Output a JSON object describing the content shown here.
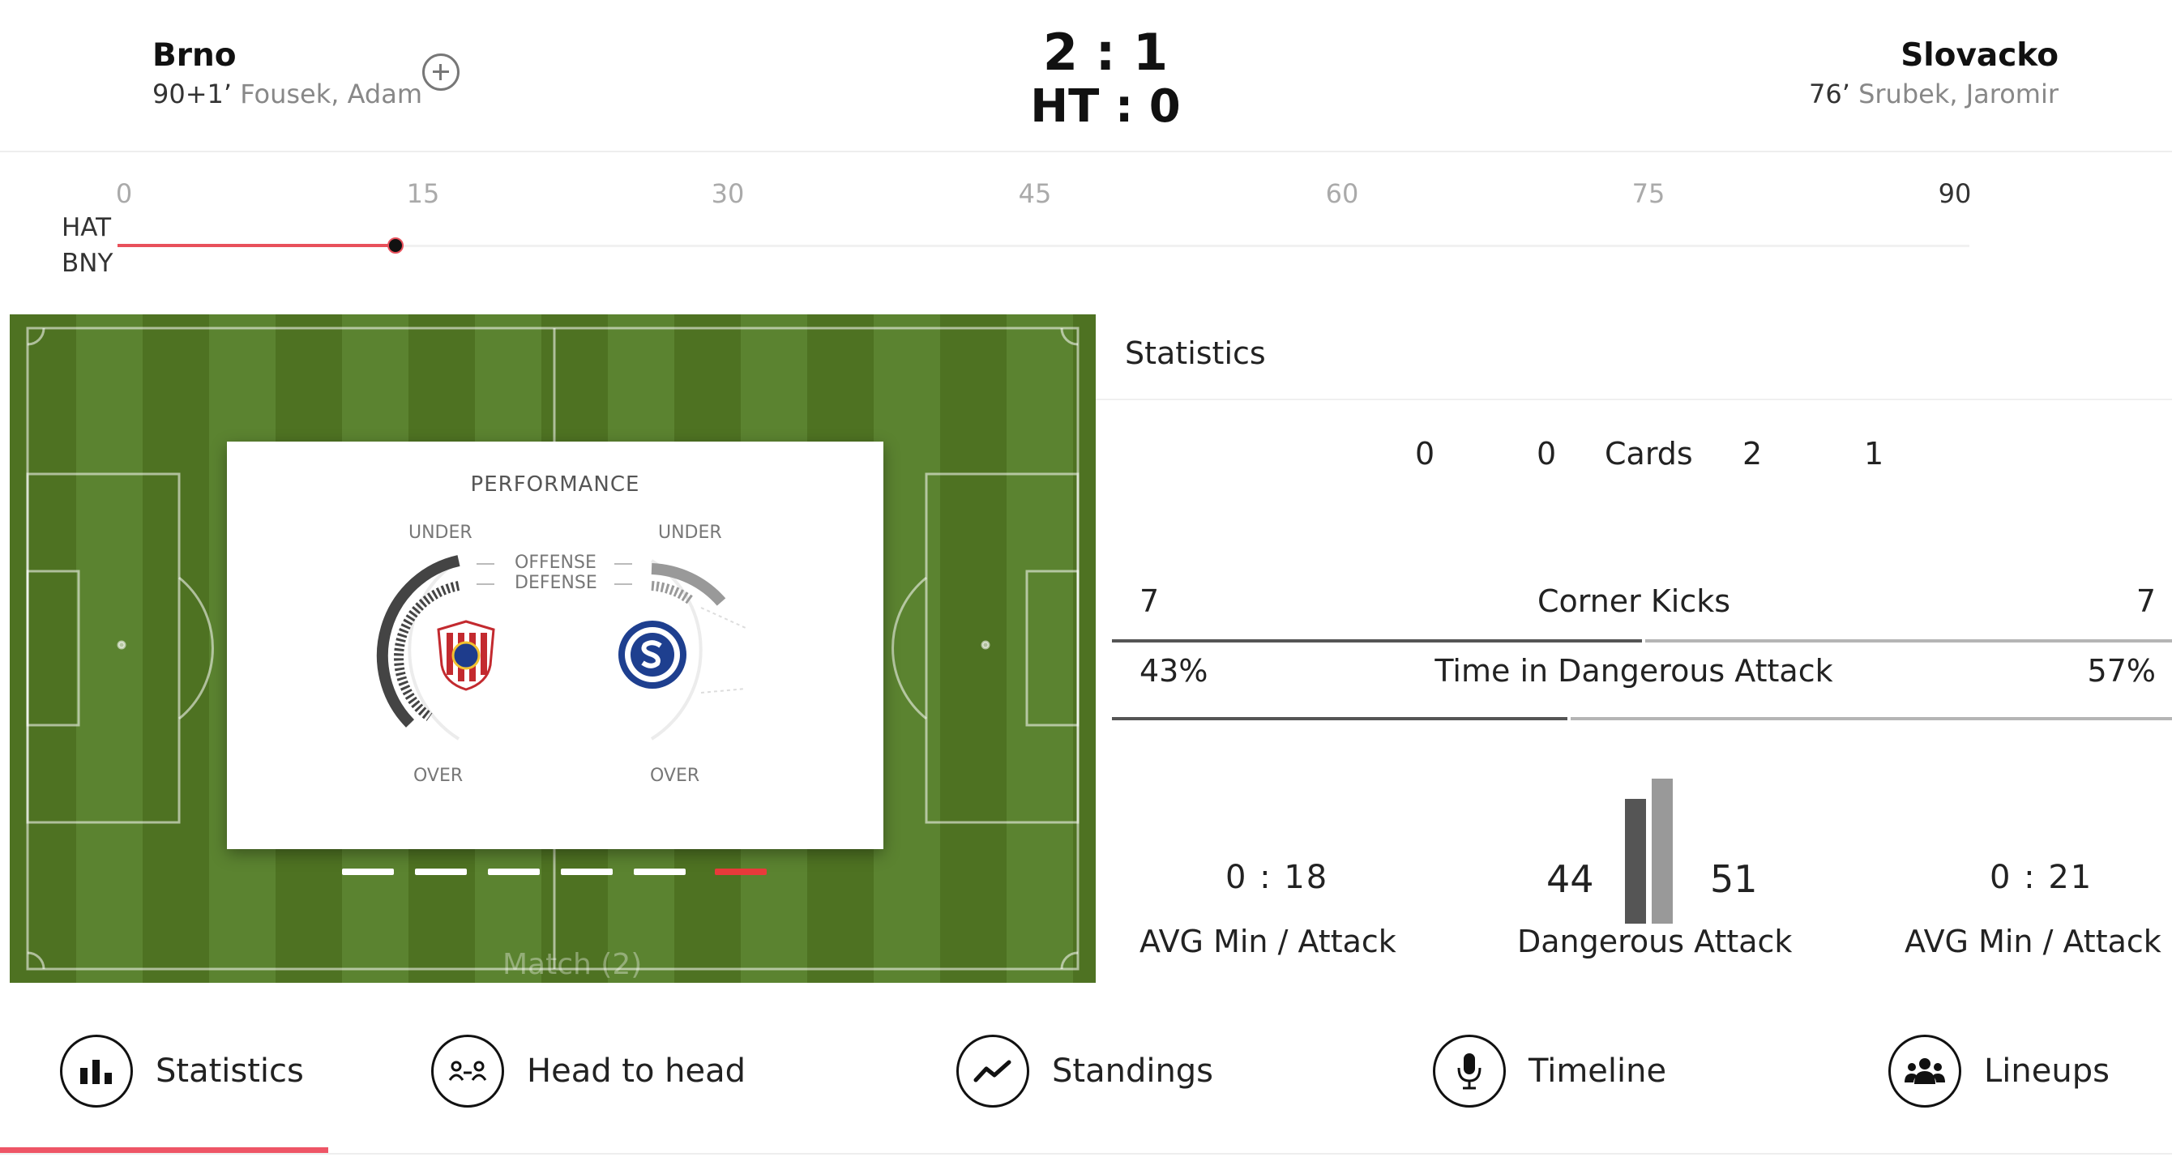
{
  "header": {
    "home": {
      "name": "Brno",
      "goal_minute": "90+1’",
      "goal_scorer": "Fousek, Adam"
    },
    "away": {
      "name": "Slovacko",
      "goal_minute": "76’",
      "goal_scorer": "Srubek, Jaromir"
    },
    "score": "2 : 1",
    "halftime": "HT : 0"
  },
  "timeline": {
    "ticks": [
      "0",
      "15",
      "30",
      "45",
      "60",
      "75",
      "90"
    ],
    "home_abbr": "HAT",
    "away_abbr": "BNY",
    "progress_minute": 13.5,
    "max_minute": 90
  },
  "pitch": {
    "card_title": "PERFORMANCE",
    "label_under": "UNDER",
    "label_over": "OVER",
    "label_offense": "OFFENSE",
    "label_defense": "DEFENSE",
    "page_dots": 6,
    "active_dot": 6,
    "caption": "Match (2)"
  },
  "statistics": {
    "title": "Statistics",
    "cards": {
      "label": "Cards",
      "home_a": "0",
      "home_b": "0",
      "away_a": "2",
      "away_b": "1"
    },
    "corner_kicks": {
      "label": "Corner Kicks",
      "home": "7",
      "away": "7",
      "home_share": 0.5
    },
    "dangerous_time": {
      "label": "Time in Dangerous Attack",
      "home": "43%",
      "away": "57%",
      "home_share": 0.43
    },
    "home_avg": {
      "value": "0 : 18",
      "label": "AVG Min / Attack"
    },
    "away_avg": {
      "value": "0 : 21",
      "label": "AVG Min / Attack"
    },
    "dangerous_attack": {
      "label": "Dangerous Attack",
      "home": "44",
      "away": "51",
      "home_value": 44,
      "away_value": 51
    }
  },
  "nav": {
    "items": [
      {
        "label": "Statistics",
        "icon": "bar-chart-icon"
      },
      {
        "label": "Head to head",
        "icon": "head-to-head-icon"
      },
      {
        "label": "Standings",
        "icon": "trend-line-icon"
      },
      {
        "label": "Timeline",
        "icon": "microphone-icon"
      },
      {
        "label": "Lineups",
        "icon": "people-icon"
      }
    ],
    "active_index": 0
  },
  "colors": {
    "accent": "#e8505b",
    "pitch_dark": "#4e7222",
    "pitch_light": "#5b8330",
    "bar_home": "#555555",
    "bar_away": "#b5b5b5"
  }
}
